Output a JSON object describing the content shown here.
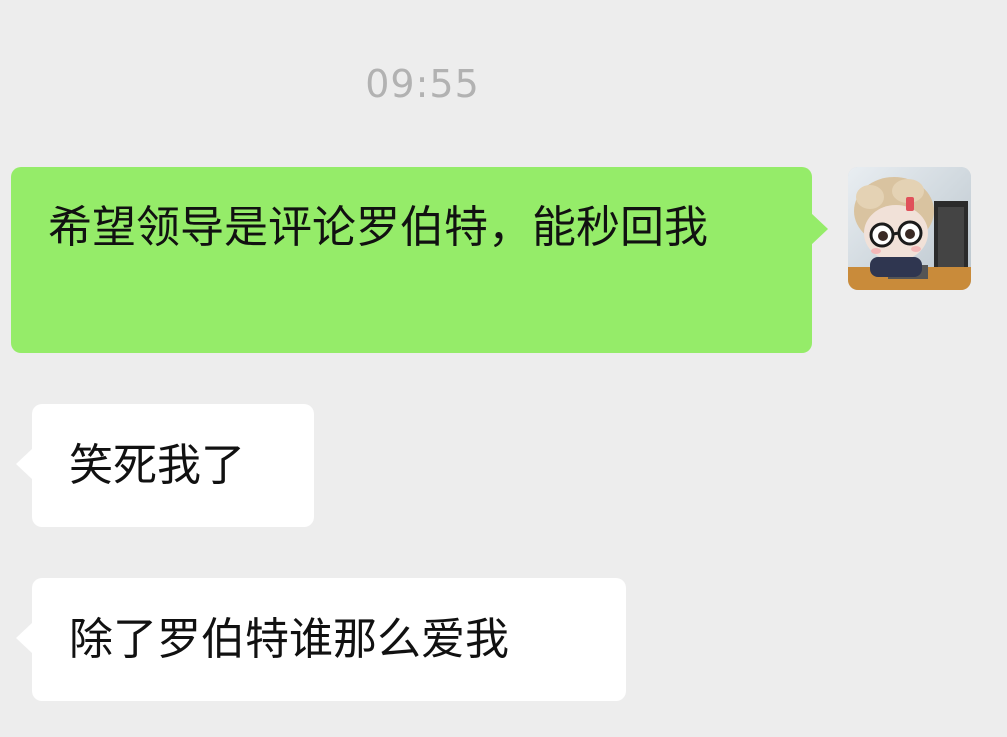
{
  "chat": {
    "timestamp": "09:55",
    "messages": [
      {
        "direction": "outgoing",
        "text": "希望领导是评论罗伯特，能秒回我",
        "bubble_color": "#95ec69"
      },
      {
        "direction": "incoming",
        "text": "笑死我了",
        "bubble_color": "#ffffff"
      },
      {
        "direction": "incoming",
        "text": "除了罗伯特谁那么爱我",
        "bubble_color": "#ffffff"
      }
    ]
  },
  "colors": {
    "background": "#ededed",
    "timestamp_text": "#b2b2b2",
    "message_text": "#111111"
  },
  "icons": {
    "avatar": "doll-with-glasses-avatar"
  }
}
